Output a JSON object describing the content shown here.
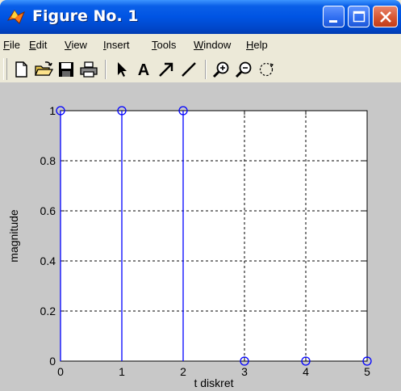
{
  "window": {
    "title": "Figure No. 1",
    "icon": "matlab-logo-icon"
  },
  "menu": [
    {
      "label": "File",
      "mnemonic": "F",
      "rest": "ile"
    },
    {
      "label": "Edit",
      "mnemonic": "E",
      "rest": "dit"
    },
    {
      "label": "View",
      "mnemonic": "V",
      "rest": "iew"
    },
    {
      "label": "Insert",
      "mnemonic": "I",
      "rest": "nsert"
    },
    {
      "label": "Tools",
      "mnemonic": "T",
      "rest": "ools"
    },
    {
      "label": "Window",
      "mnemonic": "W",
      "rest": "indow"
    },
    {
      "label": "Help",
      "mnemonic": "H",
      "rest": "elp"
    }
  ],
  "toolbar": {
    "tools": [
      "new-file-icon",
      "open-folder-icon",
      "save-icon",
      "print-icon",
      "select-arrow-icon",
      "insert-text-icon",
      "insert-arrow-icon",
      "insert-line-icon",
      "zoom-in-icon",
      "zoom-out-icon",
      "rotate-3d-icon"
    ],
    "text_tool_glyph": "A"
  },
  "colors": {
    "stem": "#0000ff",
    "grid": "#000000",
    "axes_bg": "#ffffff",
    "figure_bg": "#c8c8c8"
  },
  "chart_data": {
    "type": "stem",
    "x": [
      0,
      1,
      2,
      3,
      4,
      5
    ],
    "y": [
      1,
      1,
      1,
      0,
      0,
      0
    ],
    "xlabel": "t diskret",
    "ylabel": "magnitude",
    "xlim": [
      0,
      5
    ],
    "ylim": [
      0,
      1
    ],
    "xticks": [
      "0",
      "1",
      "2",
      "3",
      "4",
      "5"
    ],
    "yticks": [
      "0",
      "0.2",
      "0.4",
      "0.6",
      "0.8",
      "1"
    ],
    "grid": true,
    "marker": "o"
  }
}
